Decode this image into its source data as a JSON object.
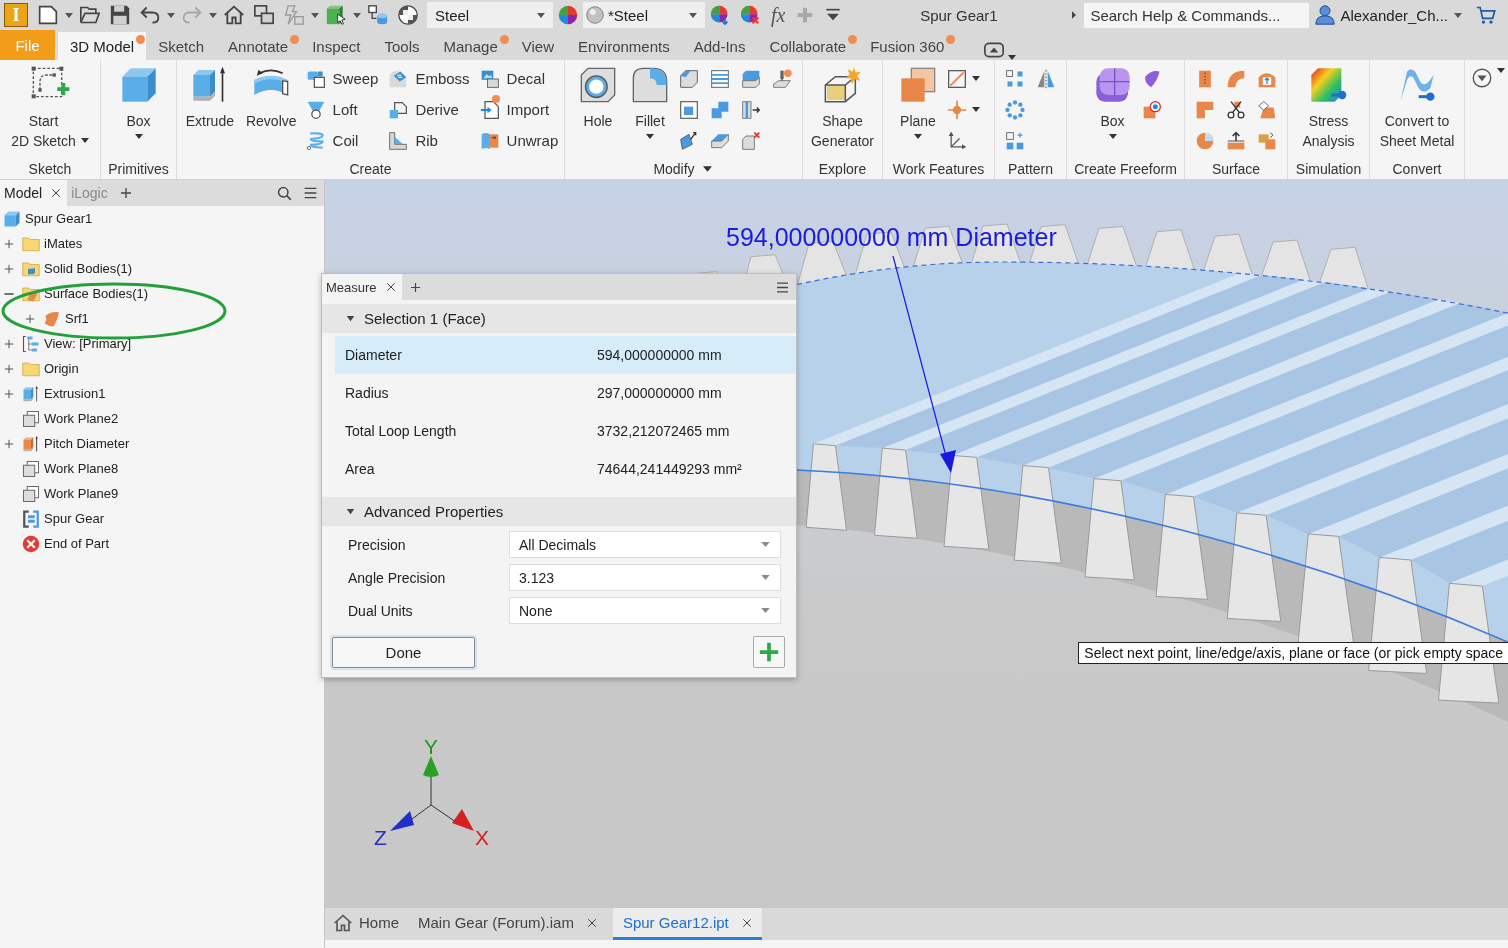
{
  "title_bar": {
    "app_logo": "I",
    "material": "Steel",
    "appearance": "*Steel",
    "formula_symbol": "fx",
    "document_title": "Spur Gear1",
    "search": {
      "placeholder": "Search Help & Commands..."
    },
    "user_name": "Alexander_Ch..."
  },
  "ribbon_tabs": [
    {
      "label": "File",
      "kind": "file",
      "selected": false,
      "notification": false
    },
    {
      "label": "3D Model",
      "kind": "tab",
      "selected": true,
      "notification": true
    },
    {
      "label": "Sketch",
      "kind": "tab",
      "selected": false,
      "notification": false
    },
    {
      "label": "Annotate",
      "kind": "tab",
      "selected": false,
      "notification": true
    },
    {
      "label": "Inspect",
      "kind": "tab",
      "selected": false,
      "notification": false
    },
    {
      "label": "Tools",
      "kind": "tab",
      "selected": false,
      "notification": false
    },
    {
      "label": "Manage",
      "kind": "tab",
      "selected": false,
      "notification": true
    },
    {
      "label": "View",
      "kind": "tab",
      "selected": false,
      "notification": false
    },
    {
      "label": "Environments",
      "kind": "tab",
      "selected": false,
      "notification": false
    },
    {
      "label": "Add-Ins",
      "kind": "tab",
      "selected": false,
      "notification": false
    },
    {
      "label": "Collaborate",
      "kind": "tab",
      "selected": false,
      "notification": true
    },
    {
      "label": "Fusion 360",
      "kind": "tab",
      "selected": false,
      "notification": true
    }
  ],
  "ribbon_groups": [
    {
      "label": "Sketch",
      "dropdown": false,
      "tools": [
        {
          "label": "Start\n2D Sketch",
          "kind": "large",
          "dropdown": true,
          "notification": false
        }
      ]
    },
    {
      "label": "Primitives",
      "dropdown": false,
      "tools": [
        {
          "label": "Box",
          "kind": "large",
          "dropdown": true,
          "notification": false
        }
      ]
    },
    {
      "label": "Create",
      "dropdown": false,
      "tools": [
        {
          "label": "Extrude",
          "kind": "large",
          "dropdown": false,
          "notification": false
        },
        {
          "label": "Revolve",
          "kind": "large",
          "dropdown": false,
          "notification": false
        },
        {
          "label": "Sweep",
          "kind": "small",
          "dropdown": false,
          "notification": false
        },
        {
          "label": "Loft",
          "kind": "small",
          "dropdown": false,
          "notification": false
        },
        {
          "label": "Coil",
          "kind": "small",
          "dropdown": false,
          "notification": false
        },
        {
          "label": "Emboss",
          "kind": "small",
          "dropdown": false,
          "notification": false
        },
        {
          "label": "Derive",
          "kind": "small",
          "dropdown": false,
          "notification": false
        },
        {
          "label": "Rib",
          "kind": "small",
          "dropdown": false,
          "notification": false
        },
        {
          "label": "Decal",
          "kind": "small",
          "dropdown": false,
          "notification": false
        },
        {
          "label": "Import",
          "kind": "small",
          "dropdown": false,
          "notification": true
        },
        {
          "label": "Unwrap",
          "kind": "small",
          "dropdown": false,
          "notification": false
        }
      ]
    },
    {
      "label": "Modify",
      "dropdown": true,
      "tools": [
        {
          "label": "Hole",
          "kind": "large",
          "dropdown": false,
          "notification": false
        },
        {
          "label": "Fillet",
          "kind": "large",
          "dropdown": true,
          "notification": false
        }
      ]
    },
    {
      "label": "Explore",
      "dropdown": false,
      "tools": [
        {
          "label": "Shape\nGenerator",
          "kind": "large",
          "dropdown": false,
          "notification": false
        }
      ]
    },
    {
      "label": "Work Features",
      "dropdown": false,
      "tools": [
        {
          "label": "Plane",
          "kind": "large",
          "dropdown": true,
          "notification": false
        }
      ]
    },
    {
      "label": "Pattern",
      "dropdown": false
    },
    {
      "label": "Create Freeform",
      "dropdown": false,
      "tools": [
        {
          "label": "Box",
          "kind": "large",
          "dropdown": true,
          "notification": false
        }
      ]
    },
    {
      "label": "Surface",
      "dropdown": false
    },
    {
      "label": "Simulation",
      "dropdown": false,
      "tools": [
        {
          "label": "Stress\nAnalysis",
          "kind": "large",
          "dropdown": false,
          "notification": false
        }
      ]
    },
    {
      "label": "Convert",
      "dropdown": false,
      "tools": [
        {
          "label": "Convert to\nSheet Metal",
          "kind": "large",
          "dropdown": false,
          "notification": false
        }
      ]
    }
  ],
  "model_browser": {
    "tabs": [
      {
        "label": "Model",
        "selected": true
      },
      {
        "label": "iLogic",
        "selected": false
      }
    ],
    "tree": [
      {
        "label": "Spur Gear1",
        "kind": "part",
        "children": [
          {
            "label": "iMates",
            "kind": "folder",
            "expanded": false
          },
          {
            "label": "Solid Bodies(1)",
            "kind": "solids",
            "expanded": false
          },
          {
            "label": "Surface Bodies(1)",
            "kind": "surfaces",
            "expanded": true,
            "children": [
              {
                "label": "Srf1",
                "kind": "surface",
                "expanded": false
              }
            ]
          },
          {
            "label": "View: [Primary]",
            "kind": "view",
            "expanded": false
          },
          {
            "label": "Origin",
            "kind": "folder",
            "expanded": false
          },
          {
            "label": "Extrusion1",
            "kind": "extrusion",
            "expanded": false
          },
          {
            "label": "Work Plane2",
            "kind": "plane"
          },
          {
            "label": "Pitch Diameter",
            "kind": "surfacing",
            "expanded": false
          },
          {
            "label": "Work Plane8",
            "kind": "plane"
          },
          {
            "label": "Work Plane9",
            "kind": "plane"
          },
          {
            "label": "Spur Gear",
            "kind": "component"
          },
          {
            "label": "End of Part",
            "kind": "end"
          }
        ]
      }
    ]
  },
  "measure_panel": {
    "tabs": [
      {
        "label": "Measure",
        "selected": true
      }
    ],
    "sections": [
      {
        "title": "Selection 1 (Face)",
        "kind": "results",
        "expanded": true,
        "rows": [
          {
            "label": "Diameter",
            "value": "594,000000000 mm",
            "selected": true
          },
          {
            "label": "Radius",
            "value": "297,000000000 mm",
            "selected": false
          },
          {
            "label": "Total Loop Length",
            "value": "3732,212072465 mm",
            "selected": false
          },
          {
            "label": "Area",
            "value": "74644,241449293 mm²",
            "selected": false
          }
        ]
      },
      {
        "title": "Advanced Properties",
        "kind": "settings",
        "expanded": true,
        "rows": [
          {
            "label": "Precision",
            "value": "All Decimals"
          },
          {
            "label": "Angle Precision",
            "value": "3.123"
          },
          {
            "label": "Dual Units",
            "value": "None"
          }
        ]
      }
    ],
    "done_button": "Done"
  },
  "viewport": {
    "dimension_label": "594,000000000 mm Diameter",
    "prompt": "Select next point, line/edge/axis, plane or face (or pick empty space",
    "axis_labels": {
      "y": "Y",
      "x": "X",
      "z": "Z"
    }
  },
  "document_tabs": [
    {
      "label": "Home",
      "kind": "home",
      "selected": false
    },
    {
      "label": "Main Gear (Forum).iam",
      "kind": "document",
      "selected": false
    },
    {
      "label": "Spur Gear12.ipt",
      "kind": "document",
      "selected": true
    }
  ]
}
